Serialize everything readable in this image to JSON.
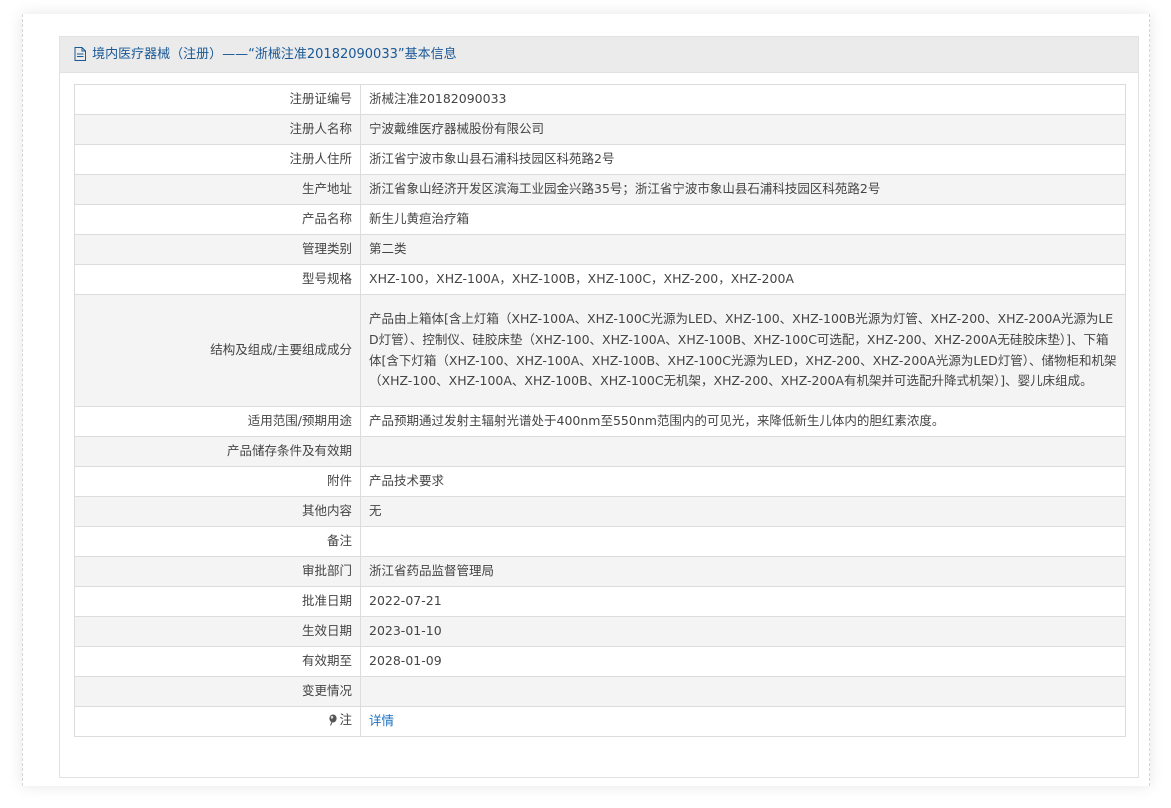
{
  "header": {
    "title": "境内医疗器械（注册）——“浙械注准20182090033”基本信息",
    "icon": "document-icon"
  },
  "rows": [
    {
      "label": "注册证编号",
      "value": "浙械注准20182090033"
    },
    {
      "label": "注册人名称",
      "value": "宁波戴维医疗器械股份有限公司"
    },
    {
      "label": "注册人住所",
      "value": "浙江省宁波市象山县石浦科技园区科苑路2号"
    },
    {
      "label": "生产地址",
      "value": "浙江省象山经济开发区滨海工业园金兴路35号；浙江省宁波市象山县石浦科技园区科苑路2号"
    },
    {
      "label": "产品名称",
      "value": "新生儿黄疸治疗箱"
    },
    {
      "label": "管理类别",
      "value": "第二类"
    },
    {
      "label": "型号规格",
      "value": "XHZ-100，XHZ-100A，XHZ-100B，XHZ-100C，XHZ-200，XHZ-200A"
    },
    {
      "label": "结构及组成/主要组成成分",
      "value": "产品由上箱体[含上灯箱（XHZ-100A、XHZ-100C光源为LED、XHZ-100、XHZ-100B光源为灯管、XHZ-200、XHZ-200A光源为LED灯管）、控制仪、硅胶床垫（XHZ-100、XHZ-100A、XHZ-100B、XHZ-100C可选配，XHZ-200、XHZ-200A无硅胶床垫）]、下箱体[含下灯箱（XHZ-100、XHZ-100A、XHZ-100B、XHZ-100C光源为LED，XHZ-200、XHZ-200A光源为LED灯管）、储物柜和机架（XHZ-100、XHZ-100A、XHZ-100B、XHZ-100C无机架，XHZ-200、XHZ-200A有机架并可选配升降式机架）]、婴儿床组成。"
    },
    {
      "label": "适用范围/预期用途",
      "value": "产品预期通过发射主辐射光谱处于400nm至550nm范围内的可见光，来降低新生儿体内的胆红素浓度。"
    },
    {
      "label": "产品储存条件及有效期",
      "value": ""
    },
    {
      "label": "附件",
      "value": "产品技术要求"
    },
    {
      "label": "其他内容",
      "value": "无"
    },
    {
      "label": "备注",
      "value": ""
    },
    {
      "label": "审批部门",
      "value": "浙江省药品监督管理局"
    },
    {
      "label": "批准日期",
      "value": "2022-07-21"
    },
    {
      "label": "生效日期",
      "value": "2023-01-10"
    },
    {
      "label": "有效期至",
      "value": "2028-01-09"
    },
    {
      "label": "变更情况",
      "value": ""
    }
  ],
  "note": {
    "label": "注",
    "link_text": "详情",
    "icon": "pin-icon"
  },
  "colors": {
    "title_text": "#1a5896",
    "link": "#1a70c0",
    "header_bg": "#ebebeb",
    "row_alt_bg": "#f4f4f4"
  }
}
